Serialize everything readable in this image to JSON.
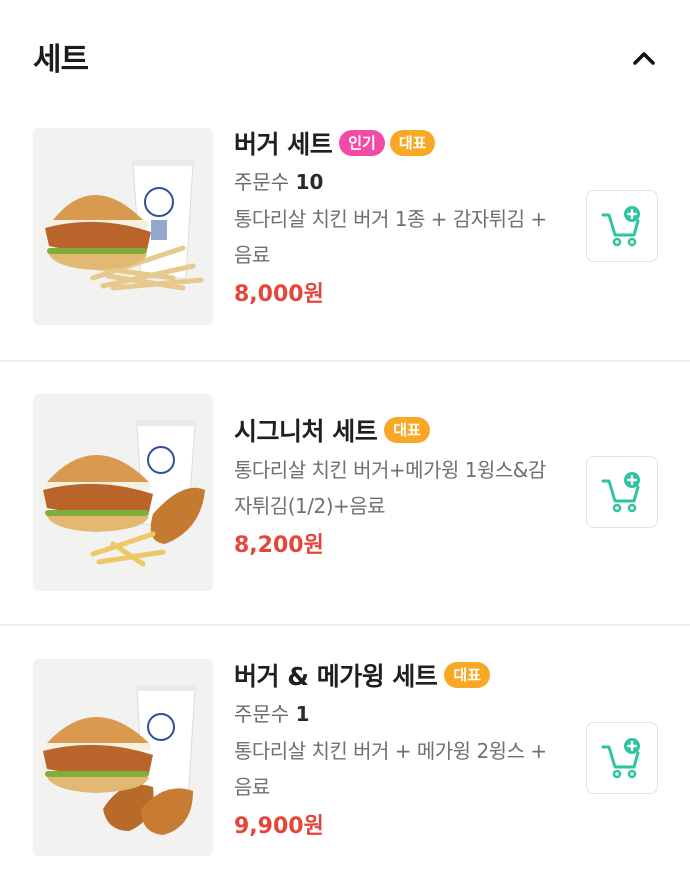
{
  "section": {
    "title": "세트",
    "collapse_icon": "chevron-up-icon"
  },
  "items": [
    {
      "name": "버거 세트",
      "badges": [
        "인기",
        "대표"
      ],
      "orders_label": "주문수",
      "orders_count": "10",
      "description": "통다리살 치킨 버거 1종 + 감자튀김 + 음료",
      "price": "8,000원",
      "cart_icon": "cart-add-icon"
    },
    {
      "name": "시그니처 세트",
      "badges": [
        "대표"
      ],
      "description": "통다리살 치킨 버거+메가윙 1윙스&감자튀김(1/2)+음료",
      "price": "8,200원",
      "cart_icon": "cart-add-icon"
    },
    {
      "name": "버거 & 메가윙 세트",
      "badges": [
        "대표"
      ],
      "orders_label": "주문수",
      "orders_count": "1",
      "description": "통다리살 치킨 버거 + 메가윙 2윙스 + 음료",
      "price": "9,900원",
      "cart_icon": "cart-add-icon"
    }
  ],
  "colors": {
    "badge_popular": "#f14ba6",
    "badge_signature": "#f9a825",
    "price": "#e5463b",
    "cart_accent": "#2ec4a0"
  }
}
